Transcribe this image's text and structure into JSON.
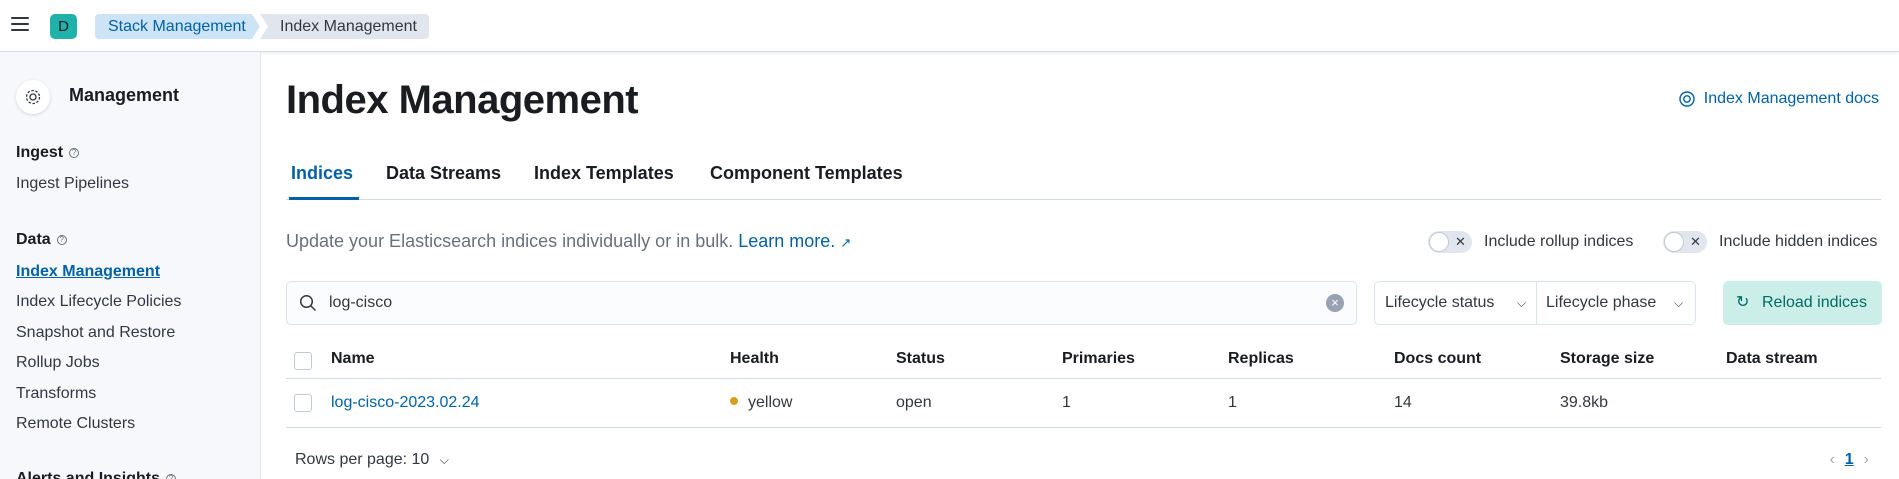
{
  "header": {
    "space_initial": "D",
    "breadcrumbs": [
      "Stack Management",
      "Index Management"
    ]
  },
  "sidebar": {
    "title": "Management",
    "sections": [
      {
        "label": "Ingest",
        "items": [
          "Ingest Pipelines"
        ]
      },
      {
        "label": "Data",
        "items": [
          "Index Management",
          "Index Lifecycle Policies",
          "Snapshot and Restore",
          "Rollup Jobs",
          "Transforms",
          "Remote Clusters"
        ]
      },
      {
        "label": "Alerts and Insights",
        "items": []
      }
    ],
    "active_item": "Index Management"
  },
  "main": {
    "title": "Index Management",
    "docs_link": "Index Management docs",
    "tabs": [
      "Indices",
      "Data Streams",
      "Index Templates",
      "Component Templates"
    ],
    "selected_tab": "Indices",
    "description": "Update your Elasticsearch indices individually or in bulk.",
    "learn_more": "Learn more.",
    "toggles": {
      "rollup": "Include rollup indices",
      "hidden": "Include hidden indices"
    },
    "search": {
      "value": "log-cisco"
    },
    "filters": [
      "Lifecycle status",
      "Lifecycle phase"
    ],
    "reload_label": "Reload indices",
    "table": {
      "columns": [
        "Name",
        "Health",
        "Status",
        "Primaries",
        "Replicas",
        "Docs count",
        "Storage size",
        "Data stream"
      ],
      "rows": [
        {
          "name": "log-cisco-2023.02.24",
          "health": "yellow",
          "status": "open",
          "primaries": "1",
          "replicas": "1",
          "docs_count": "14",
          "storage_size": "39.8kb",
          "data_stream": ""
        }
      ]
    },
    "pagination": {
      "rows_per_page": "Rows per page: 10",
      "current_page": "1"
    }
  },
  "colors": {
    "accent": "#0061a6",
    "health_yellow": "#d6a01e",
    "reload_bg": "#cceee9"
  }
}
